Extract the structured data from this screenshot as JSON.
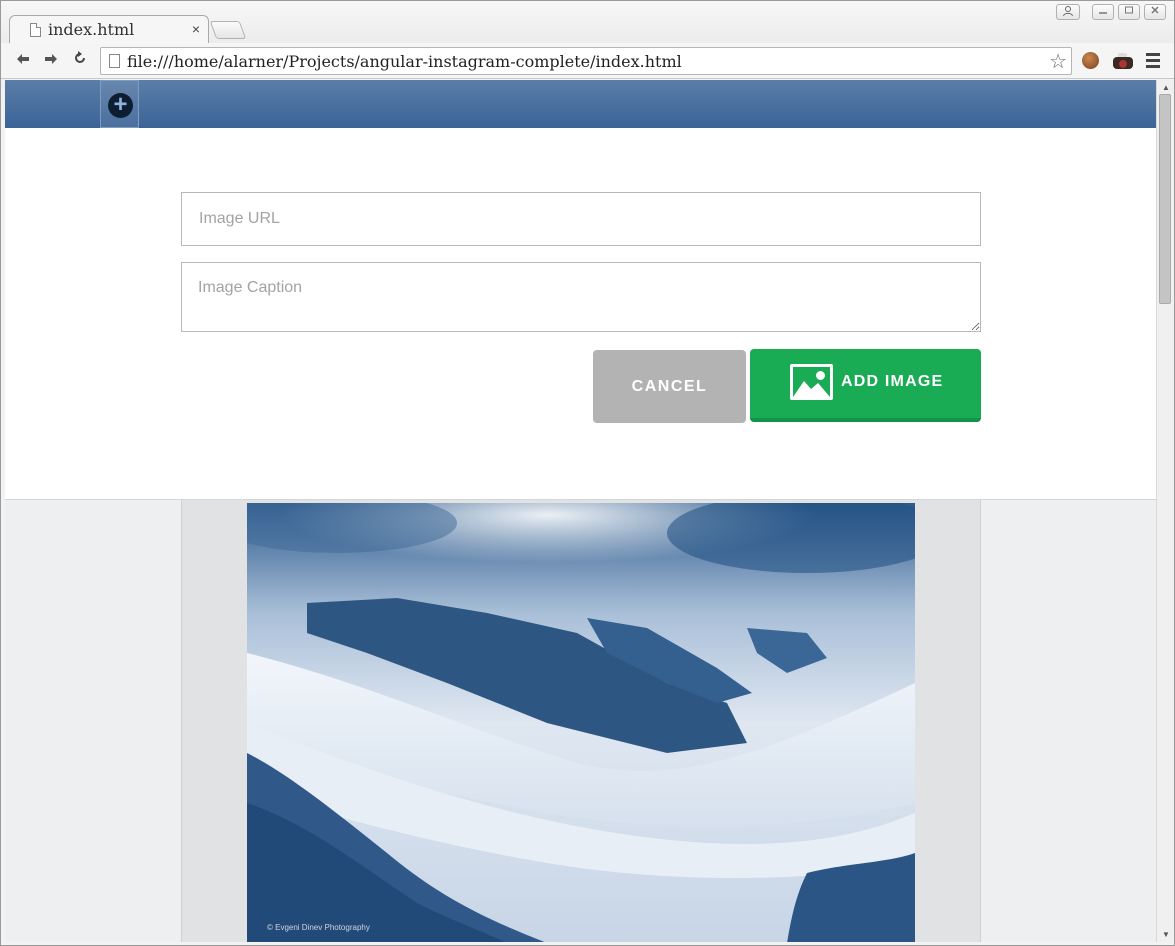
{
  "browser": {
    "tab_title": "index.html",
    "tab_close": "×",
    "url": "file:///home/alarner/Projects/angular-instagram-complete/index.html"
  },
  "app": {
    "add_toggle_glyph": "+",
    "form": {
      "url_placeholder": "Image URL",
      "url_value": "",
      "caption_placeholder": "Image Caption",
      "caption_value": "",
      "cancel_label": "CANCEL",
      "add_label": "ADD IMAGE"
    },
    "photo": {
      "credit": "© Evgeni Dinev Photography"
    }
  },
  "colors": {
    "header": "#3b6496",
    "add_button": "#1aab55",
    "cancel_button": "#b3b3b3"
  }
}
